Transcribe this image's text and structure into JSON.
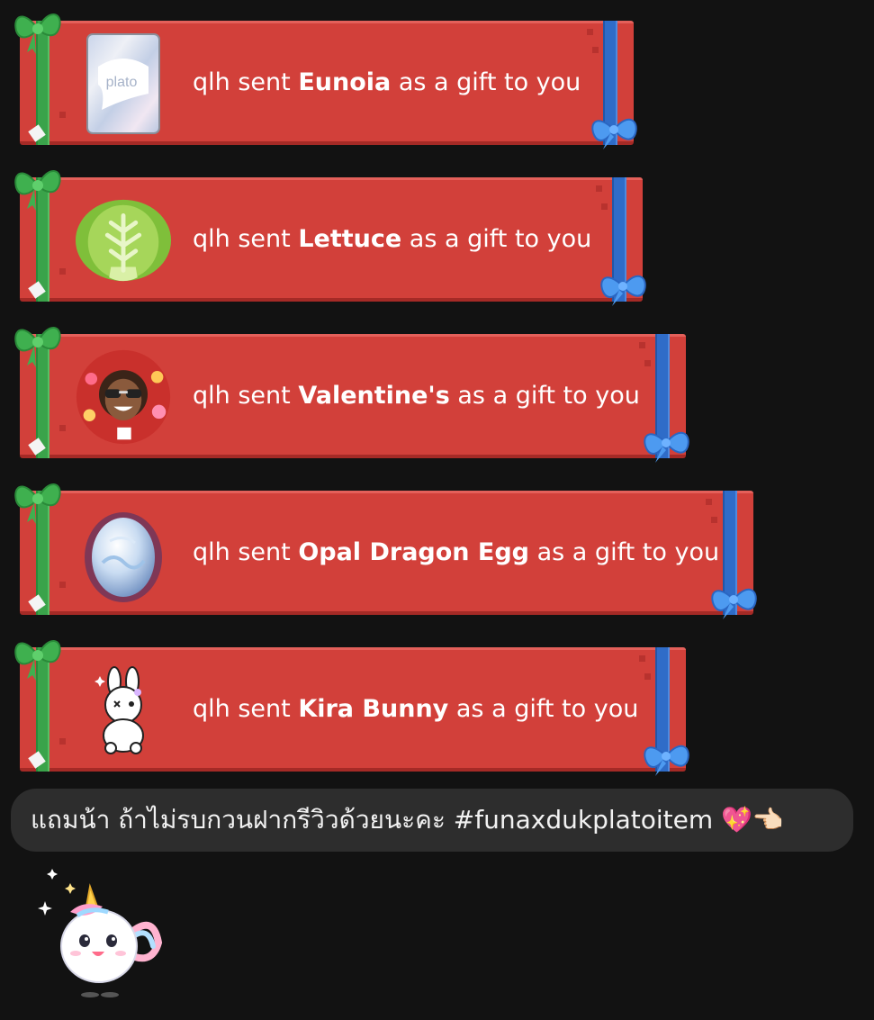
{
  "gifts": [
    {
      "sender": "qlh sent",
      "item": "Eunoia",
      "suffix": "as a gift to you",
      "thumb_icon": "plato-card-icon",
      "thumb_label": "plato"
    },
    {
      "sender": "qlh sent",
      "item": "Lettuce",
      "suffix": "as a gift to you",
      "thumb_icon": "lettuce-icon"
    },
    {
      "sender": "qlh sent",
      "item": "Valentine's",
      "suffix": "as a gift to you",
      "thumb_icon": "valentines-avatar-icon"
    },
    {
      "sender": "qlh sent",
      "item": "Opal Dragon Egg",
      "suffix": "as a gift to you",
      "thumb_icon": "opal-dragon-egg-icon"
    },
    {
      "sender": "qlh sent",
      "item": "Kira Bunny",
      "suffix": "as a gift to you",
      "thumb_icon": "kira-bunny-icon"
    }
  ],
  "message": {
    "text": "แถมน้า ถ้าไม่รบกวนฝากรีวิวด้วยนะคะ #funaxdukplatoitem 💖👈🏻"
  },
  "sticker": {
    "icon": "unicorn-sticker-icon"
  },
  "colors": {
    "background": "#121212",
    "card": "#d2403a",
    "green_ribbon": "#3aa34a",
    "blue_ribbon": "#2f6cc8",
    "bubble": "#2d2d2d"
  }
}
